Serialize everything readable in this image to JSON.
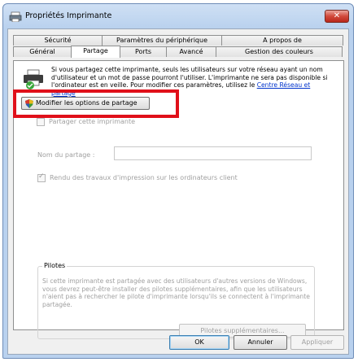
{
  "window": {
    "title": "Propriétés Imprimante",
    "close_symbol": "✕"
  },
  "tabs_top": [
    "Sécurité",
    "Paramètres du périphérique",
    "A propos de"
  ],
  "tabs_bottom": [
    "Général",
    "Partage",
    "Ports",
    "Avancé",
    "Gestion des couleurs"
  ],
  "active_tab": "Partage",
  "info": {
    "text": "Si vous partagez cette imprimante, seuls les utilisateurs sur votre réseau ayant un nom d'utilisateur et un mot de passe pourront l'utiliser. L'imprimante ne sera pas disponible si l'ordinateur est en veille. Pour modifier ces paramètres, utilisez le ",
    "link": "Centre Réseau et partage"
  },
  "share_options_button": "Modifier les options de partage",
  "share_printer_checkbox": {
    "label": "Partager cette imprimante",
    "checked": false
  },
  "share_name": {
    "label": "Nom du partage :",
    "value": ""
  },
  "render_jobs_checkbox": {
    "label": "Rendu des travaux d'impression sur les ordinateurs client",
    "checked": true
  },
  "drivers": {
    "title": "Pilotes",
    "text": "Si cette imprimante est partagée avec des utilisateurs d'autres versions de Windows, vous devrez peut-être installer des pilotes supplémentaires, afin que les utilisateurs n'aient pas à rechercher le pilote d'imprimante lorsqu'ils se connectent à l'imprimante partagée.",
    "button": "Pilotes supplémentaires..."
  },
  "buttons": {
    "ok": "OK",
    "cancel": "Annuler",
    "apply": "Appliquer"
  },
  "colors": {
    "highlight": "#e0101a",
    "link": "#0033cc"
  }
}
